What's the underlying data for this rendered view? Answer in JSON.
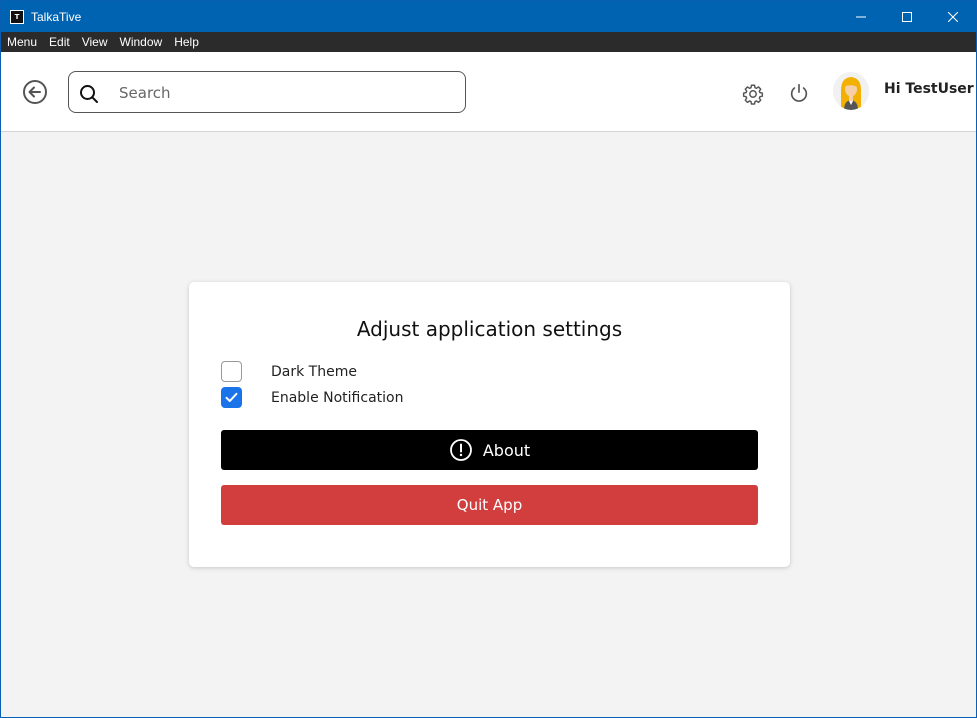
{
  "window": {
    "title": "TalkaTive",
    "app_icon_glyph": "T",
    "controls": [
      "minimize-icon",
      "maximize-icon",
      "close-icon"
    ]
  },
  "menubar": {
    "items": [
      "Menu",
      "Edit",
      "View",
      "Window",
      "Help"
    ]
  },
  "header": {
    "search": {
      "placeholder": "Search",
      "value": ""
    },
    "greeting": "Hi TestUser",
    "icons": [
      "back-arrow-icon",
      "search-icon",
      "gear-icon",
      "power-icon",
      "avatar"
    ]
  },
  "settings": {
    "title": "Adjust application settings",
    "options": [
      {
        "label": "Dark Theme",
        "checked": false
      },
      {
        "label": "Enable Notification",
        "checked": true
      }
    ],
    "about_label": "About",
    "quit_label": "Quit App"
  },
  "colors": {
    "titlebar": "#0063b1",
    "menubar": "#2b2b2b",
    "checkbox_checked": "#1a73e8",
    "about_button": "#000000",
    "quit_button": "#d23e3e",
    "background": "#f3f3f3"
  }
}
